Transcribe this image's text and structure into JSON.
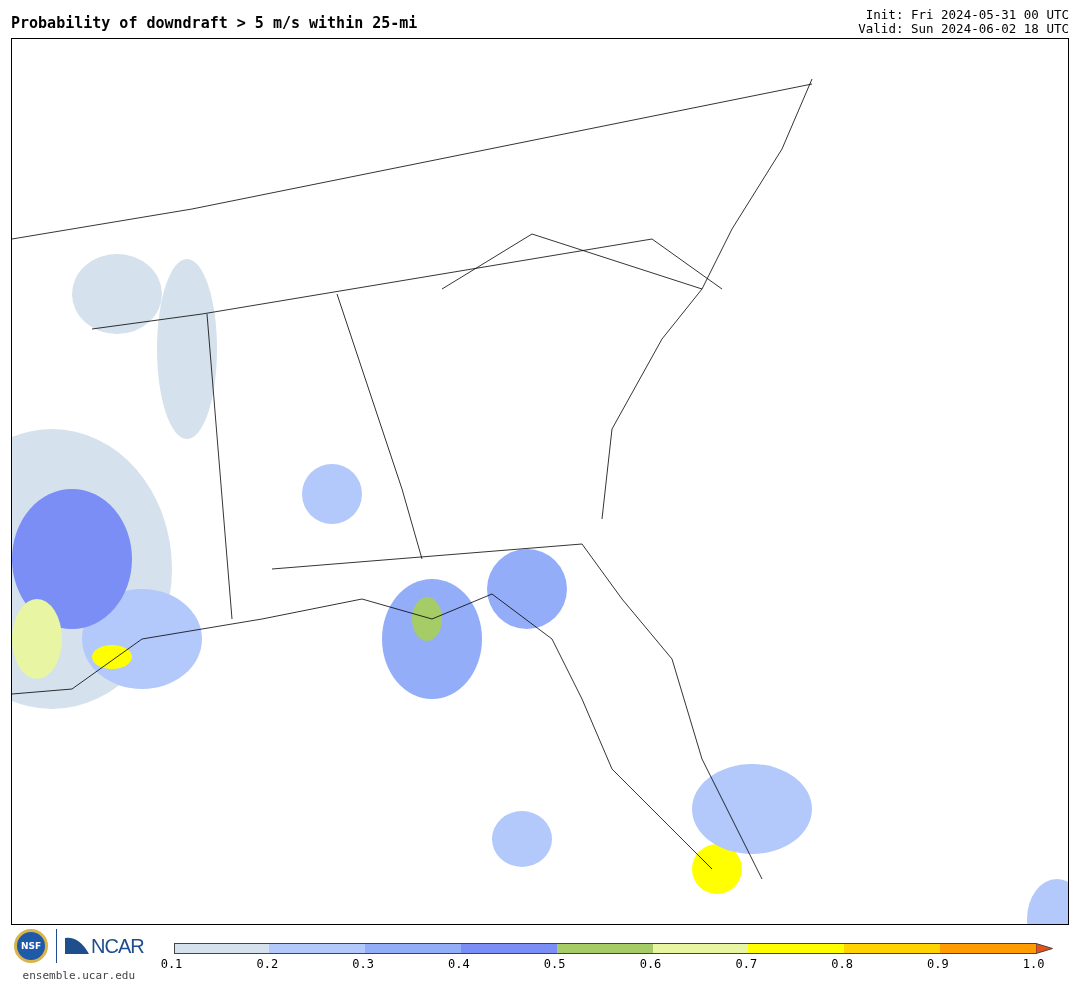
{
  "title": "Probability of downdraft > 5 m/s within 25-mi",
  "init": "Init: Fri 2024-05-31 00 UTC",
  "valid": "Valid: Sun 2024-06-02 18 UTC",
  "logos": {
    "nsf": "NSF",
    "ncar": "NCAR",
    "site": "ensemble.ucar.edu"
  },
  "colorbar": {
    "segments": [
      {
        "color": "#d5e1ed"
      },
      {
        "color": "#b3c8fb"
      },
      {
        "color": "#93adf9"
      },
      {
        "color": "#7a8ef5"
      },
      {
        "color": "#a5cc66"
      },
      {
        "color": "#e8f5a3"
      },
      {
        "color": "#ffff00"
      },
      {
        "color": "#ffd400"
      },
      {
        "color": "#ff9c00"
      },
      {
        "color": "#e8501a",
        "kind": "arrow"
      }
    ],
    "ticks": [
      "0.1",
      "0.2",
      "0.3",
      "0.4",
      "0.5",
      "0.6",
      "0.7",
      "0.8",
      "0.9",
      "1.0"
    ]
  }
}
